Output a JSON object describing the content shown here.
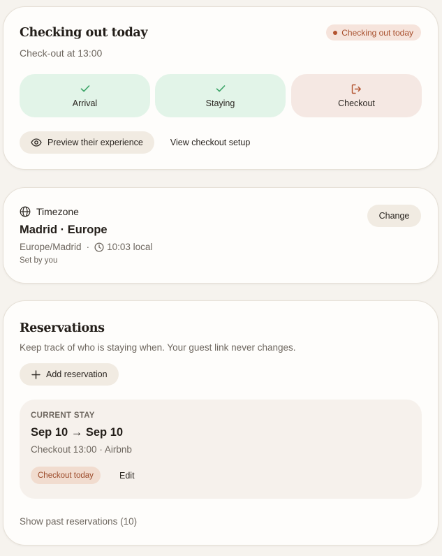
{
  "status_card": {
    "title": "Checking out today",
    "badge": "Checking out today",
    "subtitle": "Check-out at 13:00",
    "steps": [
      {
        "label": "Arrival",
        "state": "done",
        "icon": "check-icon"
      },
      {
        "label": "Staying",
        "state": "done",
        "icon": "check-icon"
      },
      {
        "label": "Checkout",
        "state": "current",
        "icon": "logout-icon"
      }
    ],
    "preview_button": "Preview their experience",
    "checkout_setup_link": "View checkout setup"
  },
  "timezone_card": {
    "heading": "Timezone",
    "name": "Madrid · Europe",
    "zone_id": "Europe/Madrid",
    "separator": "·",
    "local_time": "10:03 local",
    "set_by": "Set by you",
    "change_button": "Change"
  },
  "reservations_card": {
    "title": "Reservations",
    "description": "Keep track of who is staying when. Your guest link never changes.",
    "add_button": "Add reservation",
    "current_stay": {
      "eyebrow": "CURRENT STAY",
      "dates": "Sep 10 → Sep 10",
      "meta": "Checkout 13:00 · Airbnb",
      "badge": "Checkout today",
      "edit": "Edit"
    },
    "past_link": "Show past reservations (10)"
  },
  "colors": {
    "done_bg": "#e2f4e8",
    "done_icon": "#3aa366",
    "current_bg": "#f5e8e3",
    "current_icon": "#b3532f",
    "badge_bg": "#f6e4dc",
    "badge_text": "#a8502e",
    "button_bg": "#f1ebe2"
  }
}
